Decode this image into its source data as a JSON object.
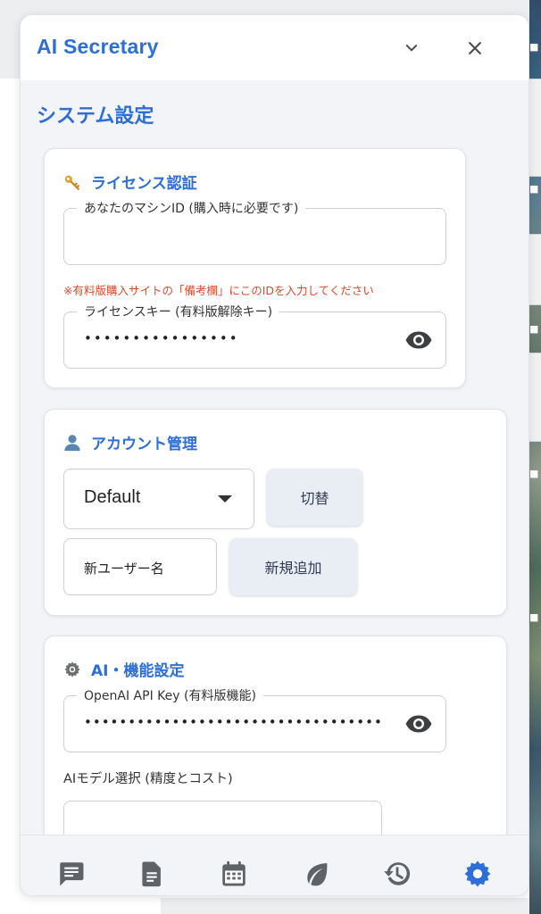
{
  "app": {
    "title": "AI Secretary"
  },
  "settings": {
    "title": "システム設定"
  },
  "license": {
    "header": "ライセンス認証",
    "machine_id_label": "あなたのマシンID (購入時に必要です)",
    "machine_id_value": "",
    "notice": "※有料版購入サイトの「備考欄」にこのIDを入力してください",
    "license_key_label": "ライセンスキー (有料版解除キー)",
    "license_key_mask": "••••••••••••••••"
  },
  "account": {
    "header": "アカウント管理",
    "selected": "Default",
    "switch_button": "切替",
    "new_user_placeholder": "新ユーザー名",
    "add_button": "新規追加"
  },
  "ai": {
    "header": "AI・機能設定",
    "api_key_label": "OpenAI API Key (有料版機能)",
    "api_key_mask": "••••••••••••••••••••••••••••••••••",
    "model_label": "AIモデル選択 (精度とコスト)"
  },
  "nav": {
    "items": [
      "chat",
      "notes",
      "calendar",
      "leaf",
      "history",
      "settings"
    ],
    "active": "settings"
  },
  "colors": {
    "accent": "#2d6fd6",
    "warning": "#d94b2b",
    "icon_gray": "#5f6368"
  }
}
